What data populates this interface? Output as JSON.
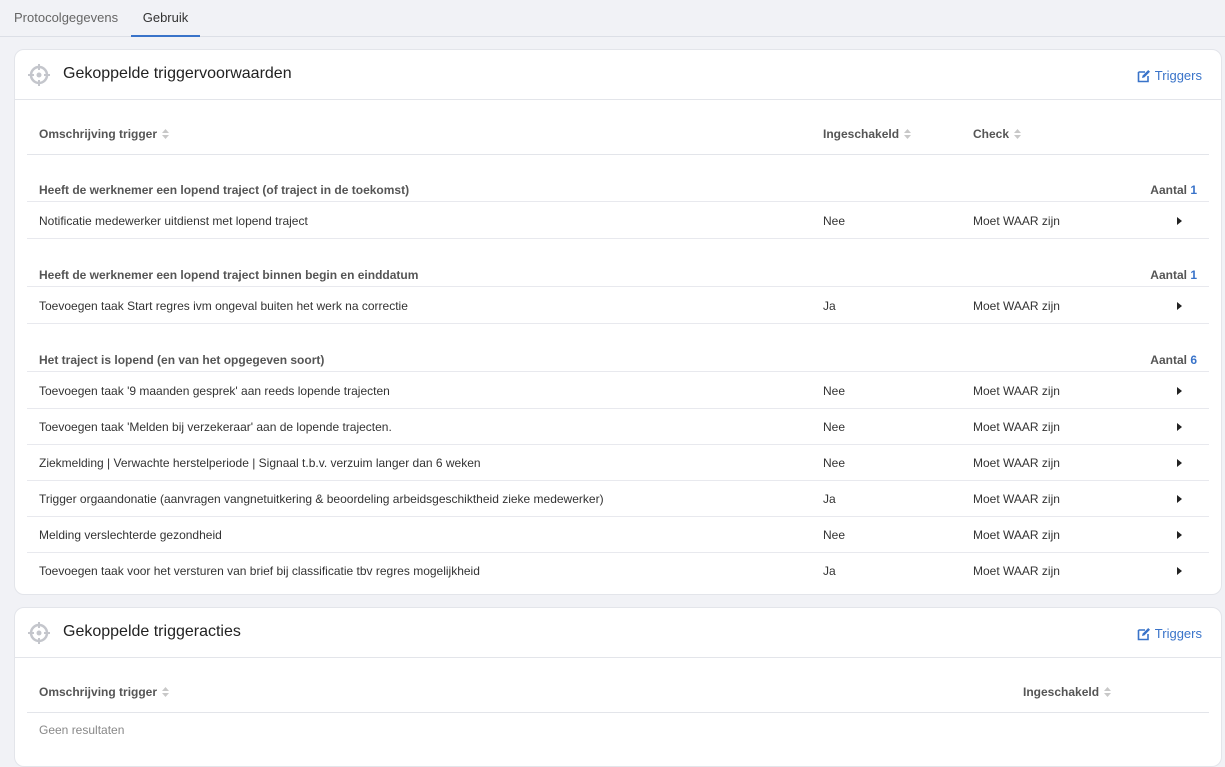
{
  "tabs": [
    {
      "label": "Protocolgegevens"
    },
    {
      "label": "Gebruik"
    }
  ],
  "conditions_card": {
    "title": "Gekoppelde triggervoorwaarden",
    "triggers_label": "Triggers",
    "columns": {
      "description": "Omschrijving trigger",
      "enabled": "Ingeschakeld",
      "check": "Check"
    },
    "count_label": "Aantal",
    "groups": [
      {
        "label": "Heeft de werknemer een lopend traject (of traject in de toekomst)",
        "count": "1",
        "rows": [
          {
            "description": "Notificatie medewerker uitdienst met lopend traject",
            "enabled": "Nee",
            "check": "Moet WAAR zijn"
          }
        ]
      },
      {
        "label": "Heeft de werknemer een lopend traject binnen begin en einddatum",
        "count": "1",
        "rows": [
          {
            "description": "Toevoegen taak Start regres ivm ongeval buiten het werk na correctie",
            "enabled": "Ja",
            "check": "Moet WAAR zijn"
          }
        ]
      },
      {
        "label": "Het traject is lopend (en van het opgegeven soort)",
        "count": "6",
        "rows": [
          {
            "description": "Toevoegen taak '9 maanden gesprek' aan reeds lopende trajecten",
            "enabled": "Nee",
            "check": "Moet WAAR zijn"
          },
          {
            "description": "Toevoegen taak 'Melden bij verzekeraar' aan de lopende trajecten.",
            "enabled": "Nee",
            "check": "Moet WAAR zijn"
          },
          {
            "description": "Ziekmelding | Verwachte herstelperiode | Signaal t.b.v. verzuim langer dan 6 weken",
            "enabled": "Nee",
            "check": "Moet WAAR zijn"
          },
          {
            "description": "Trigger orgaandonatie (aanvragen vangnetuitkering & beoordeling arbeidsgeschiktheid zieke medewerker)",
            "enabled": "Ja",
            "check": "Moet WAAR zijn"
          },
          {
            "description": "Melding verslechterde gezondheid",
            "enabled": "Nee",
            "check": "Moet WAAR zijn"
          },
          {
            "description": "Toevoegen taak voor het versturen van brief bij classificatie tbv regres mogelijkheid",
            "enabled": "Ja",
            "check": "Moet WAAR zijn"
          }
        ]
      }
    ]
  },
  "actions_card": {
    "title": "Gekoppelde triggeracties",
    "triggers_label": "Triggers",
    "columns": {
      "description": "Omschrijving trigger",
      "enabled": "Ingeschakeld"
    },
    "empty_text": "Geen resultaten"
  },
  "icons": {
    "header": "crosshair-icon",
    "triggers": "edit-icon",
    "sort": "sort-icon",
    "expand": "caret-right-icon"
  },
  "colors": {
    "accent": "#3973c9",
    "icon_gray": "#c4c6cc"
  }
}
